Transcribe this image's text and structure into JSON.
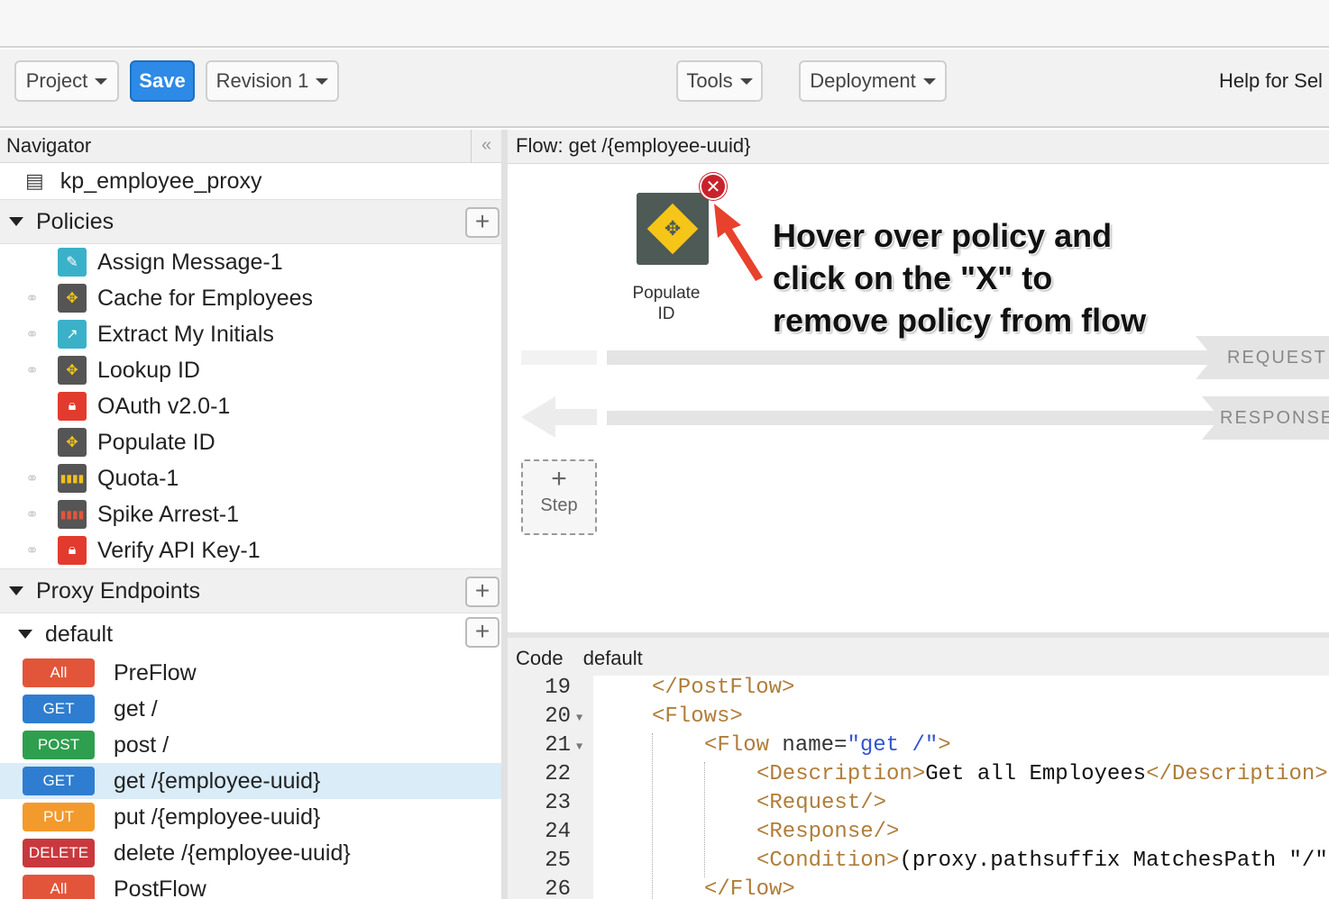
{
  "toolbar": {
    "project": "Project",
    "save": "Save",
    "revision": "Revision 1",
    "tools": "Tools",
    "deployment": "Deployment",
    "help": "Help for Sel"
  },
  "navigator": {
    "title": "Navigator",
    "collapse_glyph": "«",
    "proxy_name": "kp_employee_proxy",
    "policies_label": "Policies",
    "policies": [
      {
        "name": "Assign Message-1",
        "icon": "assign-message-icon"
      },
      {
        "name": "Cache for Employees",
        "icon": "flow-callout-icon"
      },
      {
        "name": "Extract My Initials",
        "icon": "extract-variables-icon"
      },
      {
        "name": "Lookup ID",
        "icon": "flow-callout-icon"
      },
      {
        "name": "OAuth v2.0-1",
        "icon": "lock-icon"
      },
      {
        "name": "Populate ID",
        "icon": "flow-callout-icon"
      },
      {
        "name": "Quota-1",
        "icon": "quota-icon"
      },
      {
        "name": "Spike Arrest-1",
        "icon": "spike-arrest-icon"
      },
      {
        "name": "Verify API Key-1",
        "icon": "lock-icon"
      }
    ],
    "proxy_endpoints_label": "Proxy Endpoints",
    "default_label": "default",
    "flows": [
      {
        "verb": "All",
        "label": "PreFlow"
      },
      {
        "verb": "GET",
        "label": "get /"
      },
      {
        "verb": "POST",
        "label": "post /"
      },
      {
        "verb": "GET",
        "label": "get /{employee-uuid}"
      },
      {
        "verb": "PUT",
        "label": "put /{employee-uuid}"
      },
      {
        "verb": "DELETE",
        "label": "delete /{employee-uuid}"
      },
      {
        "verb": "All",
        "label": "PostFlow"
      }
    ]
  },
  "flow_panel": {
    "title": "Flow: get /{employee-uuid}",
    "policy_label_line1": "Populate",
    "policy_label_line2": "ID",
    "annotation_line1": "Hover over policy and",
    "annotation_line2": "click on the \"X\" to",
    "annotation_line3": "remove policy from flow",
    "request_label": "REQUEST",
    "response_label": "RESPONSE",
    "step_plus": "+",
    "step_label": "Step"
  },
  "code_panel": {
    "tab1": "Code",
    "tab2": "default",
    "line_numbers": [
      "19",
      "20",
      "21",
      "22",
      "23",
      "24",
      "25",
      "26"
    ],
    "line19": "</PostFlow>",
    "line20": "<Flows>",
    "line21_tag": "<Flow ",
    "line21_attr": "name=",
    "line21_str": "\"get /\"",
    "line21_end": ">",
    "line22_open": "<Description>",
    "line22_text": "Get all Employees",
    "line22_close": "</Description>",
    "line23": "<Request/>",
    "line24": "<Response/>",
    "line25_open": "<Condition>",
    "line25_text": "(proxy.pathsuffix MatchesPath \"/\"",
    "line26": "</Flow>"
  },
  "colors": {
    "save": "#2d8ae6",
    "verb_all": "#e2553b",
    "verb_get": "#2f7dd0",
    "verb_post": "#2e9f4e",
    "verb_put": "#f39a2c",
    "verb_delete": "#c9383d",
    "remove_x": "#c8232c",
    "annotation_arrow": "#e8412c"
  }
}
